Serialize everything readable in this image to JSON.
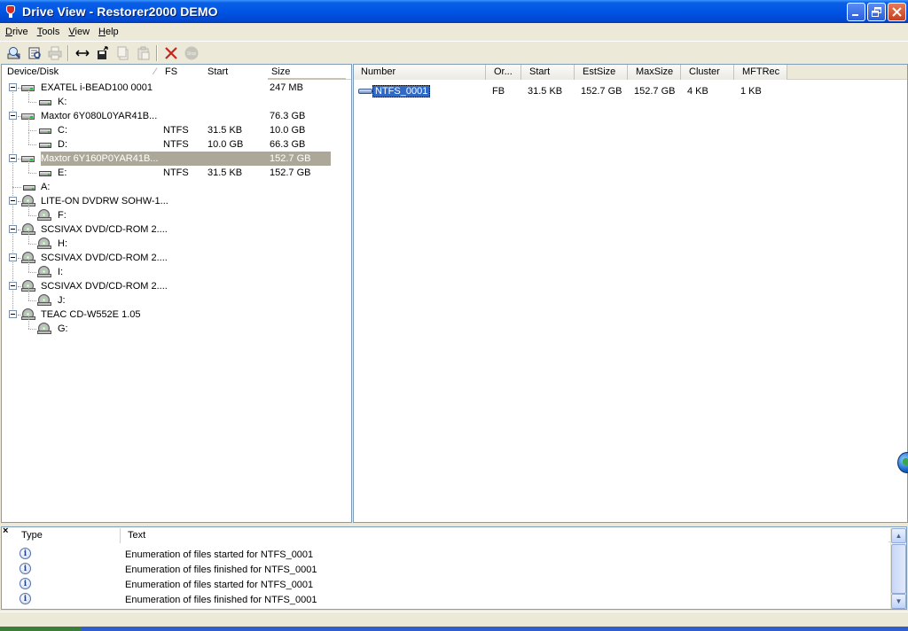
{
  "window": {
    "title": "Drive View - Restorer2000 DEMO"
  },
  "menu": [
    {
      "pre": "",
      "u": "D",
      "post": "rive"
    },
    {
      "pre": "",
      "u": "T",
      "post": "ools"
    },
    {
      "pre": "",
      "u": "V",
      "post": "iew"
    },
    {
      "pre": "",
      "u": "H",
      "post": "elp"
    }
  ],
  "toolbar": {
    "icons": [
      "open-drive-icon",
      "scan-icon",
      "print-icon",
      "resize-icon",
      "save-icon",
      "copy-icon",
      "paste-icon",
      "delete-icon",
      "stop-icon"
    ],
    "stop_label": "Stop"
  },
  "left": {
    "columns": [
      "Device/Disk",
      "FS",
      "Start",
      "Size"
    ],
    "rows": [
      {
        "name": "EXATEL i-BEAD100 0001",
        "fs": "",
        "start": "",
        "size": "247 MB"
      },
      {
        "name": "K:",
        "fs": "",
        "start": "",
        "size": ""
      },
      {
        "name": "Maxtor 6Y080L0YAR41B...",
        "fs": "",
        "start": "",
        "size": "76.3 GB"
      },
      {
        "name": "C:",
        "fs": "NTFS",
        "start": "31.5 KB",
        "size": "10.0 GB"
      },
      {
        "name": "D:",
        "fs": "NTFS",
        "start": "10.0 GB",
        "size": "66.3 GB"
      },
      {
        "name": "Maxtor 6Y160P0YAR41B...",
        "fs": "",
        "start": "",
        "size": "152.7 GB"
      },
      {
        "name": "E:",
        "fs": "NTFS",
        "start": "31.5 KB",
        "size": "152.7 GB"
      },
      {
        "name": "A:",
        "fs": "",
        "start": "",
        "size": ""
      },
      {
        "name": "LITE-ON DVDRW SOHW-1...",
        "fs": "",
        "start": "",
        "size": ""
      },
      {
        "name": "F:",
        "fs": "",
        "start": "",
        "size": ""
      },
      {
        "name": "SCSIVAX DVD/CD-ROM 2....",
        "fs": "",
        "start": "",
        "size": ""
      },
      {
        "name": "H:",
        "fs": "",
        "start": "",
        "size": ""
      },
      {
        "name": "SCSIVAX DVD/CD-ROM 2....",
        "fs": "",
        "start": "",
        "size": ""
      },
      {
        "name": "I:",
        "fs": "",
        "start": "",
        "size": ""
      },
      {
        "name": "SCSIVAX DVD/CD-ROM 2....",
        "fs": "",
        "start": "",
        "size": ""
      },
      {
        "name": "J:",
        "fs": "",
        "start": "",
        "size": ""
      },
      {
        "name": "TEAC CD-W552E 1.05",
        "fs": "",
        "start": "",
        "size": ""
      },
      {
        "name": "G:",
        "fs": "",
        "start": "",
        "size": ""
      }
    ]
  },
  "right": {
    "columns": [
      "Number",
      "Or...",
      "Start",
      "EstSize",
      "MaxSize",
      "Cluster",
      "MFTRec"
    ],
    "rows": [
      {
        "number": "NTFS_0001",
        "or": "FB",
        "start": "31.5 KB",
        "estsize": "152.7 GB",
        "maxsize": "152.7 GB",
        "cluster": "4 KB",
        "mftrec": "1 KB"
      }
    ]
  },
  "log": {
    "close": "×",
    "columns": [
      "Type",
      "Text"
    ],
    "info_glyph": "i",
    "rows": [
      "Enumeration of files started for NTFS_0001",
      "Enumeration of files finished for NTFS_0001",
      "Enumeration of files started for NTFS_0001",
      "Enumeration of files finished for NTFS_0001"
    ]
  }
}
